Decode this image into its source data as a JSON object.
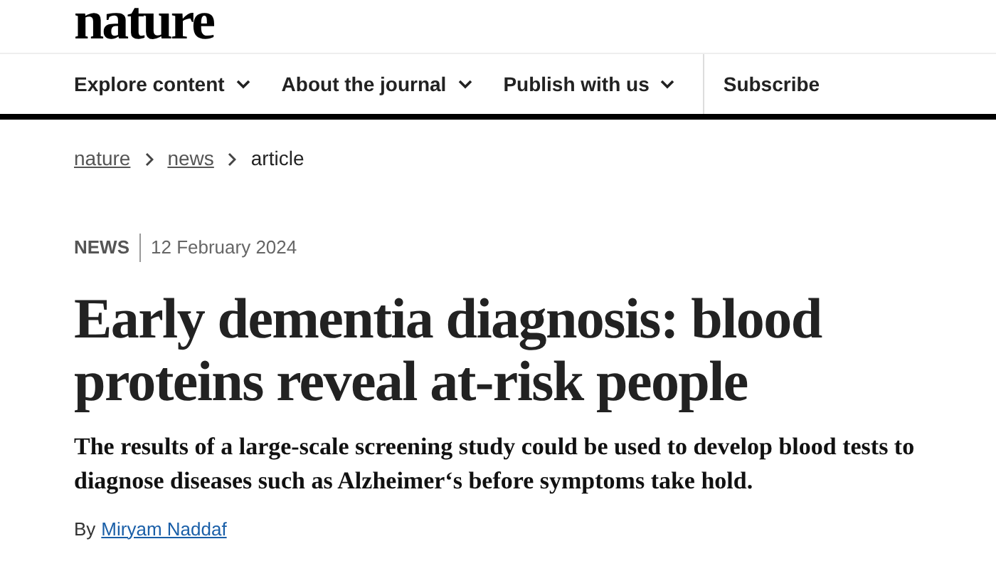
{
  "logo": "nature",
  "nav": [
    {
      "label": "Explore content",
      "dropdown": true
    },
    {
      "label": "About the journal",
      "dropdown": true
    },
    {
      "label": "Publish with us",
      "dropdown": true
    },
    {
      "label": "Subscribe",
      "dropdown": false
    }
  ],
  "breadcrumb": [
    {
      "label": "nature",
      "link": true
    },
    {
      "label": "news",
      "link": true
    },
    {
      "label": "article",
      "link": false
    }
  ],
  "article": {
    "type": "NEWS",
    "date": "12 February 2024",
    "title": "Early dementia diagnosis: blood proteins reveal at-risk people",
    "standfirst": "The results of a large-scale screening study could be used to develop blood tests to diagnose diseases such as Alzheimer‘s before symptoms take hold.",
    "byline_prefix": "By",
    "author": "Miryam Naddaf"
  }
}
